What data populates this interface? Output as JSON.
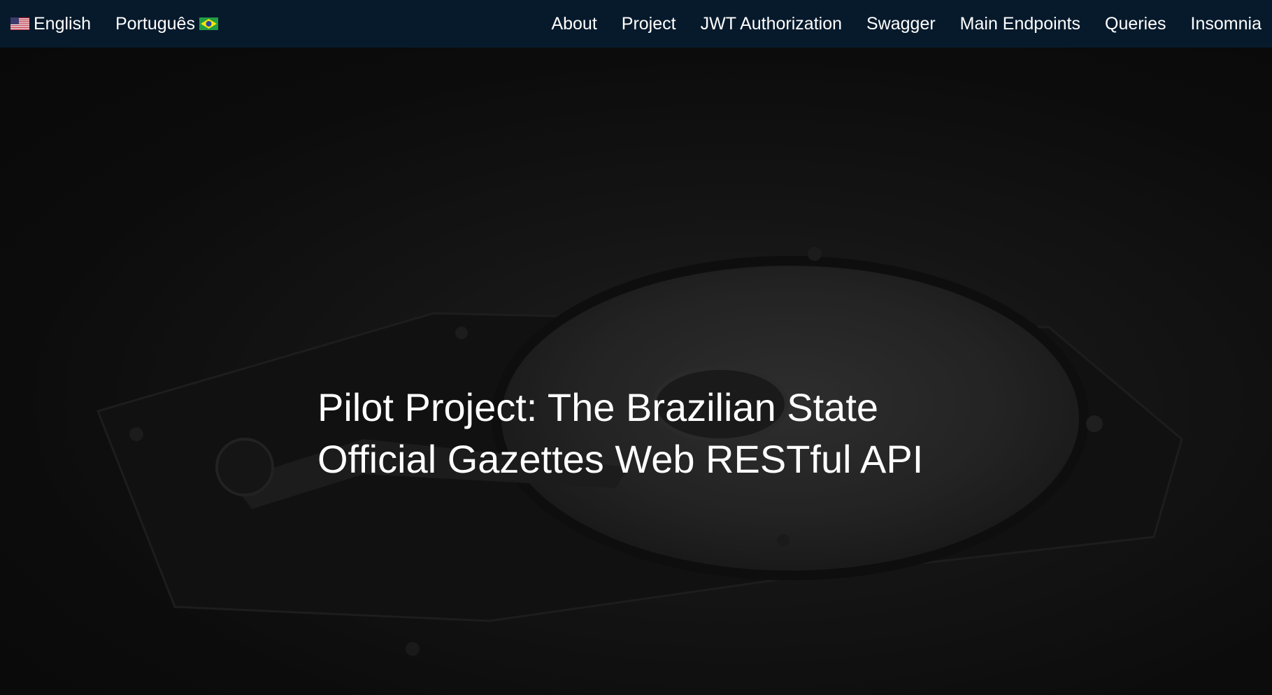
{
  "nav": {
    "languages": [
      {
        "label": "English",
        "flag": "us-flag-icon"
      },
      {
        "label": "Português",
        "flag": "brazil-flag-icon"
      }
    ],
    "links": [
      "About",
      "Project",
      "JWT Authorization",
      "Swagger",
      "Main Endpoints",
      "Queries",
      "Insomnia"
    ]
  },
  "hero": {
    "title_strong": "Pilot Project",
    "title_rest_1": ": The Brazilian State",
    "title_rest_2": "Official Gazettes Web RESTful API",
    "background": "hard-drive-photo"
  },
  "colors": {
    "navbar_bg": "#071a2c",
    "text": "#ffffff",
    "hero_bg": "#0b0b0b"
  }
}
